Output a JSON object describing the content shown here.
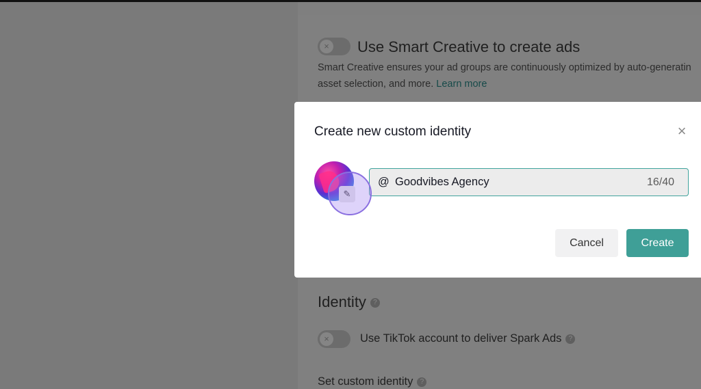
{
  "background": {
    "smart_creative": {
      "title": "Use Smart Creative to create ads",
      "description_line1": "Smart Creative ensures your ad groups are continuously optimized by auto-generatin",
      "description_line2": "asset selection, and more.",
      "learn_more": "Learn more"
    },
    "identity": {
      "heading": "Identity",
      "tiktok_toggle_label": "Use TikTok account to deliver Spark Ads",
      "custom_identity_label": "Set custom identity"
    }
  },
  "modal": {
    "title": "Create new custom identity",
    "identity_input": {
      "prefix": "@",
      "value": "Goodvibes Agency",
      "counter": "16/40"
    },
    "cancel_label": "Cancel",
    "create_label": "Create"
  },
  "icons": {
    "close": "×",
    "toggle_off": "×",
    "edit": "✎",
    "help": "?"
  },
  "colors": {
    "accent": "#3f9f97",
    "overlay": "#7f7f7f"
  }
}
